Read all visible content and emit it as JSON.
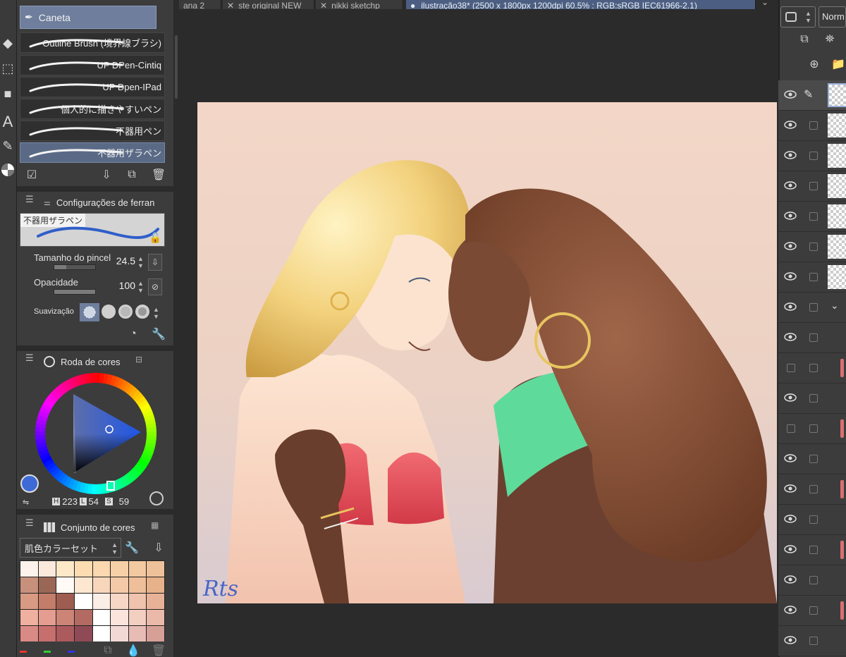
{
  "tabs": [
    {
      "label": "ana 2"
    },
    {
      "label": "ste original NEW"
    },
    {
      "label": "nikki sketchp"
    },
    {
      "label": "ilustração38* (2500 x 1800px 1200dpi 60.5% : RGB:sRGB IEC61966-2.1)"
    }
  ],
  "brush_panel": {
    "header": "Caneta",
    "brushes": [
      {
        "label": "Outline Brush (境界線ブラシ)"
      },
      {
        "label": "UP DPen-Cintiq"
      },
      {
        "label": "UP Dpen-IPad"
      },
      {
        "label": "個人的に描きやすいペン"
      },
      {
        "label": "不器用ペン"
      },
      {
        "label": "不器用ザラペン",
        "selected": true
      }
    ]
  },
  "tool_settings": {
    "title": "Configurações de ferran",
    "preview_name": "不器用ザラペン",
    "brush_size_label": "Tamanho do pincel",
    "brush_size_value": "24.5",
    "brush_size_fraction": 0.3,
    "opacity_label": "Opacidade",
    "opacity_value": "100",
    "opacity_fraction": 1.0,
    "smoothing_label": "Suavização c"
  },
  "color_wheel": {
    "title": "Roda de cores",
    "h_label": "H",
    "h_value": "223",
    "l_label": "L",
    "l_value": "54",
    "s_label": "S",
    "s_value": "59",
    "main_color": "#3d6ad6",
    "sub_color": "#ffffff"
  },
  "color_set": {
    "title": "Conjunto de cores",
    "selected_set": "肌色カラーセット",
    "swatches": [
      "#fdf3ec",
      "#fbe9dc",
      "#fde8c8",
      "#fcdcb0",
      "#fbd8b0",
      "#f6d0a6",
      "#f2c9a0",
      "#efc19a",
      "#c7907d",
      "#9a6756",
      "#fffaf6",
      "#fde7d0",
      "#f8d6bb",
      "#f4c9a7",
      "#efbf99",
      "#e7b18a",
      "#d89a82",
      "#c47d69",
      "#9e5d50",
      "#ffffff",
      "#fbeee6",
      "#f6d7c6",
      "#efc3ad",
      "#e8b299",
      "#f0b0a0",
      "#e49d90",
      "#cc8477",
      "#b36a62",
      "#ffffff",
      "#fae4dc",
      "#f3cfc2",
      "#ebb9a9",
      "#d98a84",
      "#c66f6d",
      "#ad5a5e",
      "#8f4a55",
      "#ffffff",
      "#f3d9d5",
      "#e6bcb5",
      "#d6a097"
    ]
  },
  "layers_panel": {
    "blend_mode": "Norm"
  },
  "canvas": {
    "signature": "Rts"
  }
}
